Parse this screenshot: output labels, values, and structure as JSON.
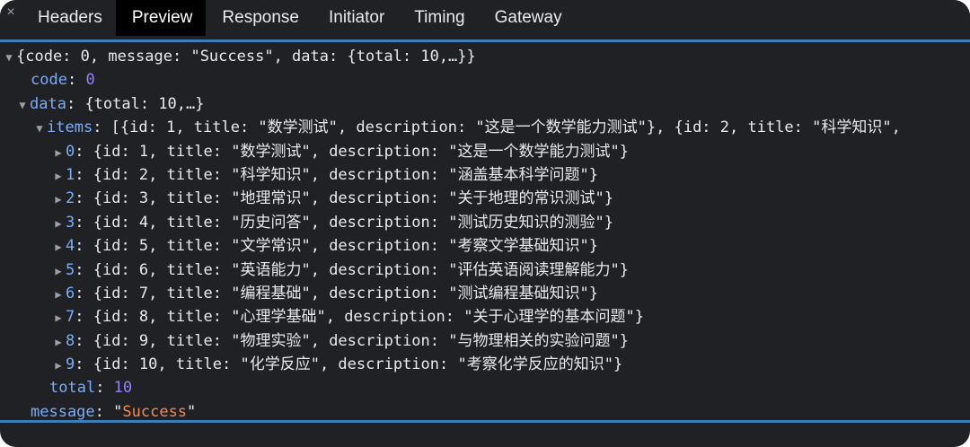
{
  "tabs": [
    "Headers",
    "Preview",
    "Response",
    "Initiator",
    "Timing",
    "Gateway"
  ],
  "active_tab": "Preview",
  "close_glyph": "×",
  "tree": {
    "root_summary": "{code: 0, message: \"Success\", data: {total: 10,…}}",
    "code_key": "code",
    "code_value": "0",
    "data_key": "data",
    "data_summary": "{total: 10,…}",
    "items_key": "items",
    "items_summary": "[{id: 1, title: \"数学测试\", description: \"这是一个数学能力测试\"}, {id: 2, title: \"科学知识\",",
    "items": [
      {
        "index": "0",
        "summary": "{id: 1, title: \"数学测试\", description: \"这是一个数学能力测试\"}"
      },
      {
        "index": "1",
        "summary": "{id: 2, title: \"科学知识\", description: \"涵盖基本科学问题\"}"
      },
      {
        "index": "2",
        "summary": "{id: 3, title: \"地理常识\", description: \"关于地理的常识测试\"}"
      },
      {
        "index": "3",
        "summary": "{id: 4, title: \"历史问答\", description: \"测试历史知识的测验\"}"
      },
      {
        "index": "4",
        "summary": "{id: 5, title: \"文学常识\", description: \"考察文学基础知识\"}"
      },
      {
        "index": "5",
        "summary": "{id: 6, title: \"英语能力\", description: \"评估英语阅读理解能力\"}"
      },
      {
        "index": "6",
        "summary": "{id: 7, title: \"编程基础\", description: \"测试编程基础知识\"}"
      },
      {
        "index": "7",
        "summary": "{id: 8, title: \"心理学基础\", description: \"关于心理学的基本问题\"}"
      },
      {
        "index": "8",
        "summary": "{id: 9, title: \"物理实验\", description: \"与物理相关的实验问题\"}"
      },
      {
        "index": "9",
        "summary": "{id: 10, title: \"化学反应\", description: \"考察化学反应的知识\"}"
      }
    ],
    "total_key": "total",
    "total_value": "10",
    "message_key": "message",
    "message_value": "Success",
    "quote": "\""
  },
  "colors": {
    "background": "#202124",
    "key": "#7cacf8",
    "number": "#9980ff",
    "string": "#f28b54",
    "divider": "#3d7fb8"
  },
  "icons": {
    "expanded": "triangle-down-icon",
    "collapsed": "triangle-right-icon"
  }
}
